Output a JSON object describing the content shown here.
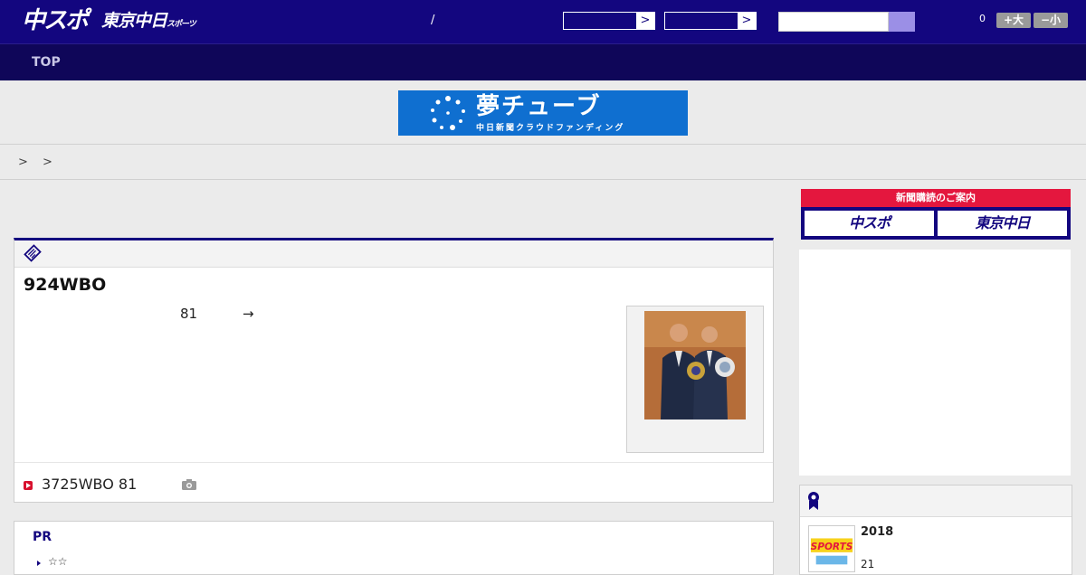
{
  "header": {
    "logo_primary": "中スポ",
    "logo_secondary": "東京中日",
    "logo_secondary_small": "スポーツ",
    "slash": "/",
    "select1_arrow": ">",
    "select2_arrow": ">",
    "font_count": "0",
    "font_larger": "+大",
    "font_smaller": "−小"
  },
  "nav": {
    "top": "TOP"
  },
  "banner": {
    "title": "夢チューブ",
    "subtitle": "中日新聞クラウドファンディング"
  },
  "breadcrumb": {
    "text": ">  >"
  },
  "article": {
    "title": "924WBO",
    "num": "81",
    "arrow": "→",
    "related": "3725WBO 81"
  },
  "pr": {
    "title": "PR",
    "items": [
      "☆☆"
    ]
  },
  "sidebar": {
    "subscribe_title": "新聞購読のご案内",
    "sub_left": "中スポ",
    "sub_right": "東京中日",
    "ranking": {
      "year": "2018",
      "sub": "21"
    }
  },
  "colors": {
    "brand": "#13067f",
    "nav": "#0f0659",
    "accent_red": "#e4173e",
    "banner_blue": "#0f6fd0"
  }
}
